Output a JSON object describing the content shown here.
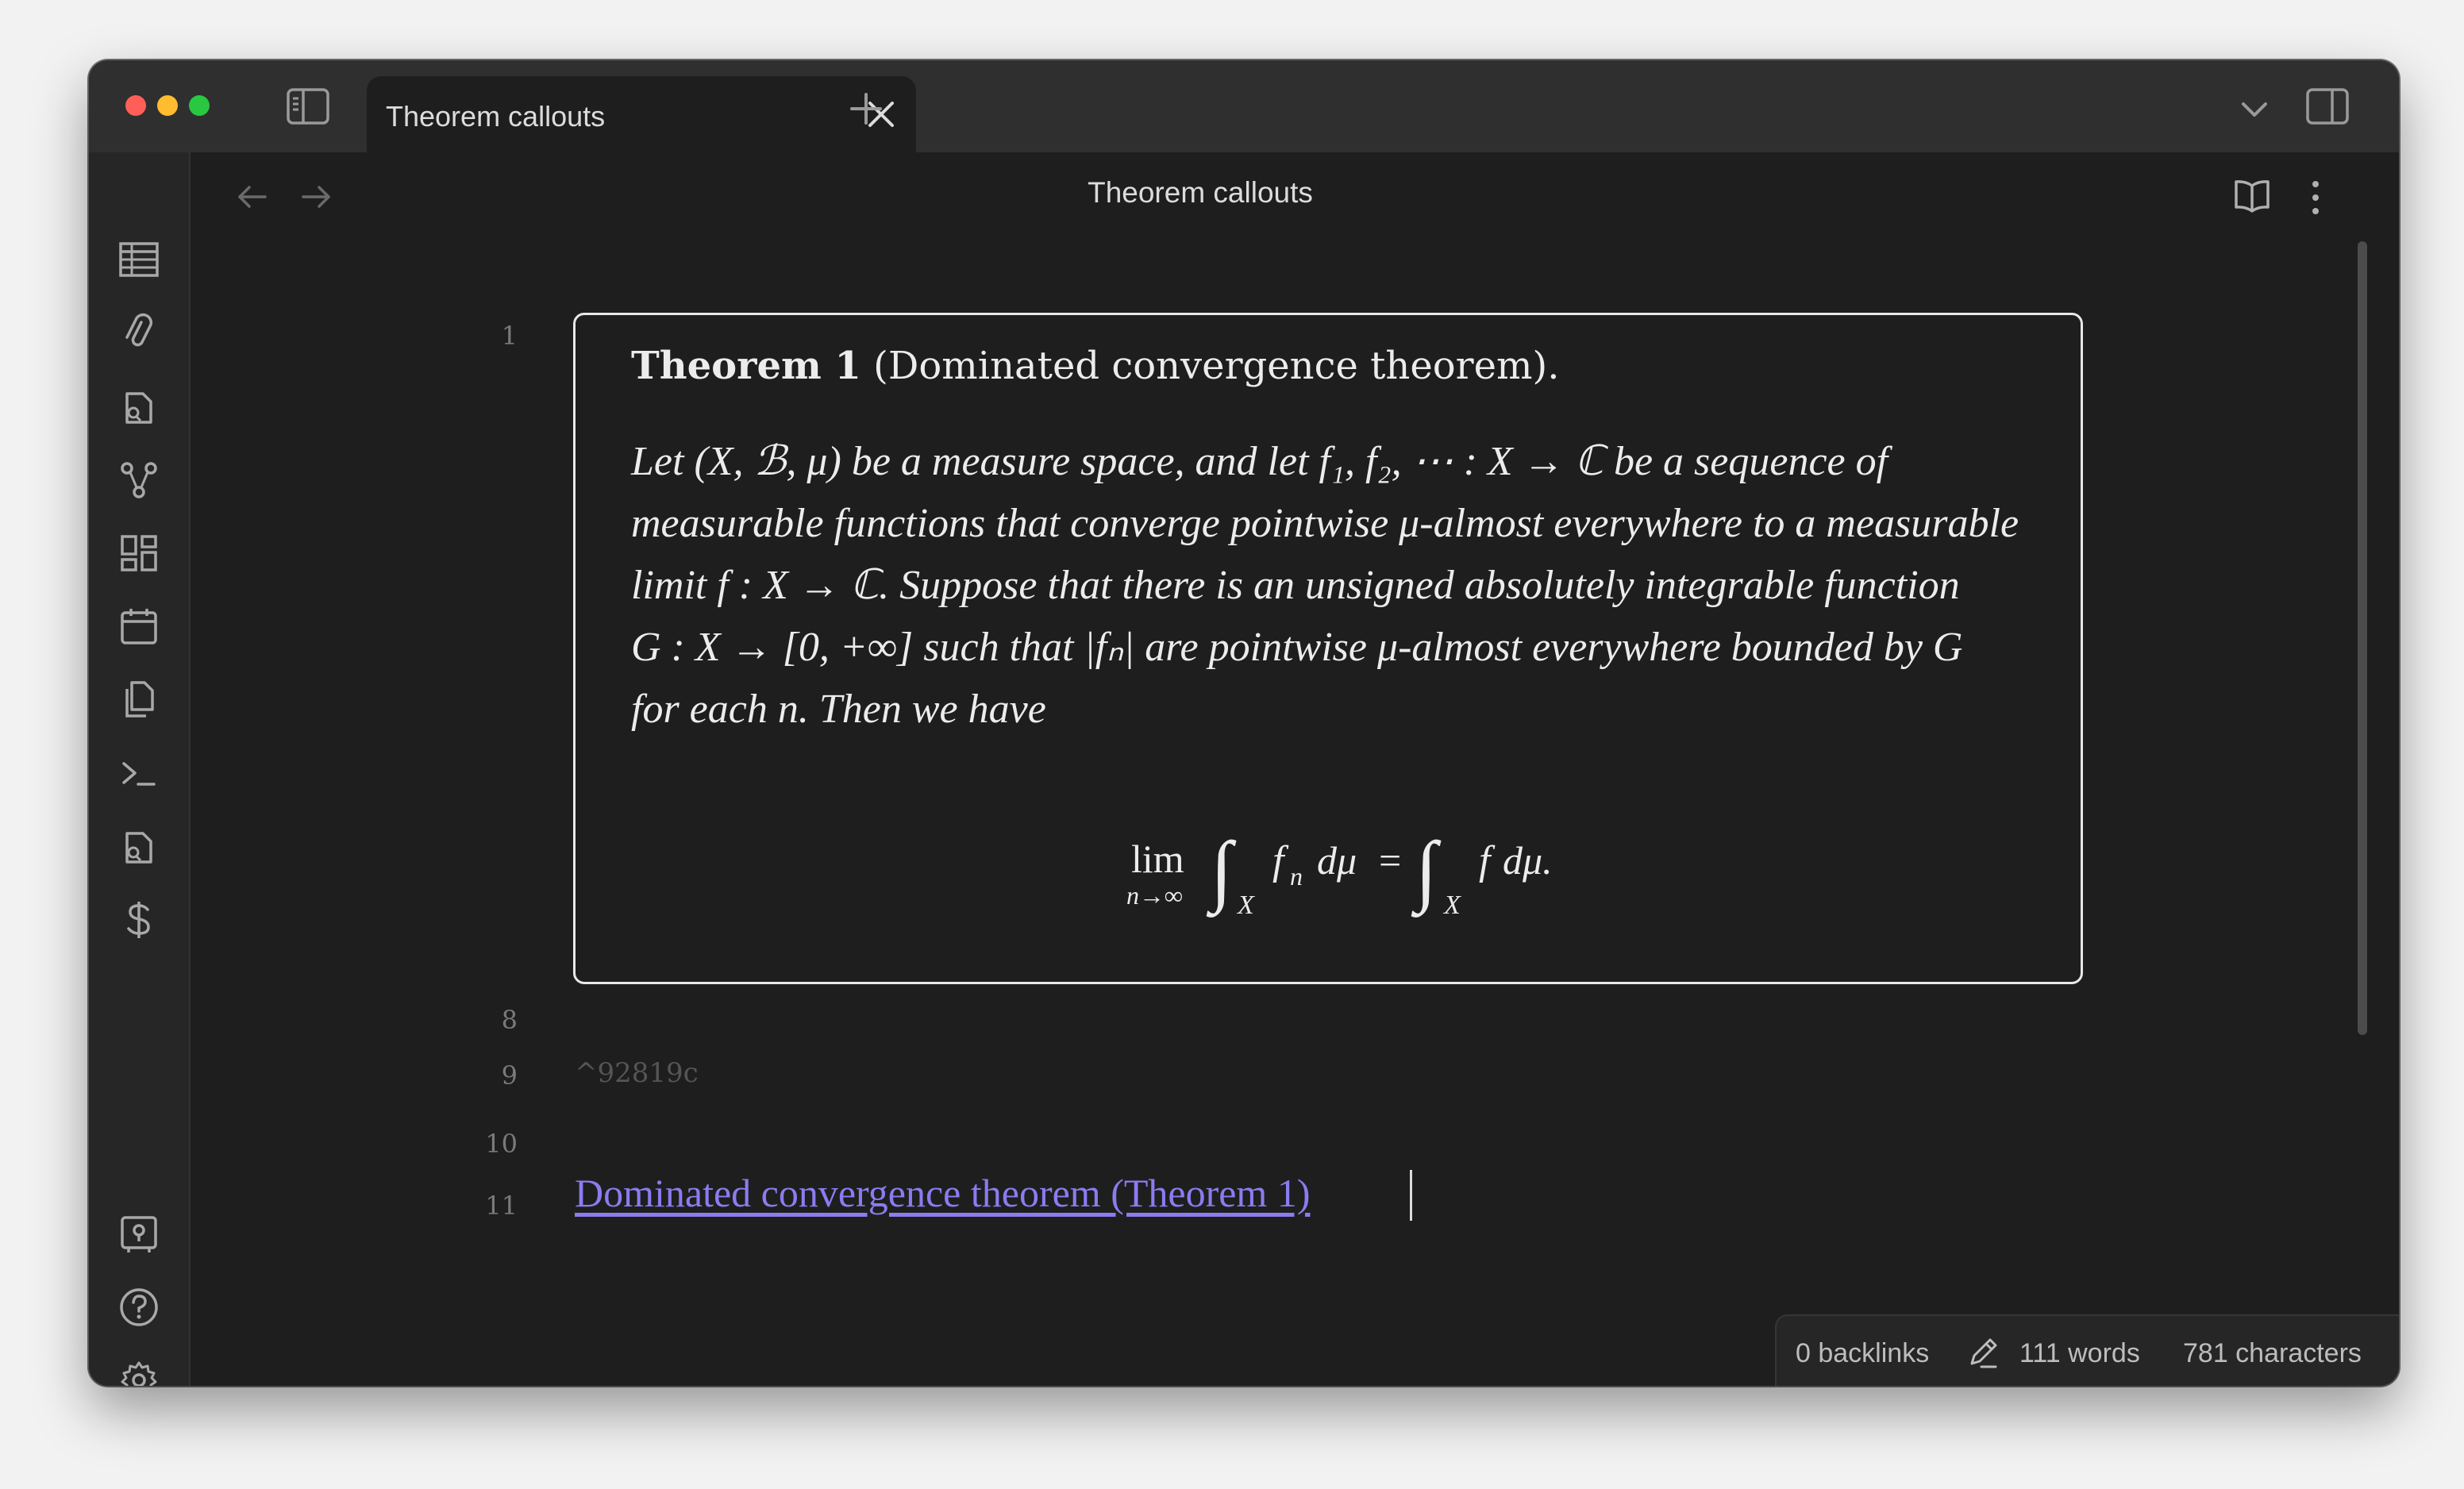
{
  "app": {
    "tab_title": "Theorem callouts",
    "view_title": "Theorem callouts"
  },
  "window_controls": [
    "close",
    "minimize",
    "zoom"
  ],
  "titlebar_icons": [
    "sidebar-left-icon",
    "close-icon",
    "plus-icon",
    "chevron-down-icon",
    "sidebar-right-icon"
  ],
  "ribbon": {
    "top_items": [
      {
        "name": "table-icon"
      },
      {
        "name": "paperclip-icon"
      },
      {
        "name": "file-search-icon"
      },
      {
        "name": "graph-icon"
      },
      {
        "name": "dashboard-icon"
      },
      {
        "name": "calendar-icon"
      },
      {
        "name": "copy-icon"
      },
      {
        "name": "terminal-icon"
      },
      {
        "name": "file-search-alt-icon"
      },
      {
        "name": "dollar-icon"
      }
    ],
    "bottom_items": [
      {
        "name": "vault-icon"
      },
      {
        "name": "help-icon"
      },
      {
        "name": "settings-icon"
      }
    ]
  },
  "editor": {
    "line_numbers": [
      "1",
      "8",
      "9",
      "10",
      "11"
    ],
    "callout": {
      "title_bold": "Theorem 1",
      "title_rest": " (Dominated convergence theorem).",
      "body_lines": [
        "Let (X, ℬ, μ) be a measure space, and let f₁, f₂, ⋯ : X → ℂ be a sequence of",
        "measurable functions that converge pointwise μ-almost everywhere to a measurable",
        "limit f : X → ℂ. Suppose that there is an unsigned absolutely integrable function",
        "G : X → [0, +∞] such that |fₙ| are pointwise μ-almost everywhere bounded by G",
        "for each n. Then we have"
      ],
      "formula": {
        "lim": "lim",
        "lim_sub": "n→∞",
        "integral": "∫",
        "domain": "X",
        "lhs_integrand": "f",
        "lhs_sub": "n",
        "lhs_measure": "dμ",
        "equals": "=",
        "rhs_integrand": "f",
        "rhs_measure": "dμ."
      }
    },
    "block_id": "^92819c",
    "link_text": "Dominated convergence theorem (Theorem 1)"
  },
  "status": {
    "backlinks": "0 backlinks",
    "words": "111 words",
    "characters": "781 characters"
  },
  "colors": {
    "background": "#1e1e1e",
    "titlebar": "#2f2f2f",
    "link": "#8a7cf0",
    "text": "#ececec"
  }
}
